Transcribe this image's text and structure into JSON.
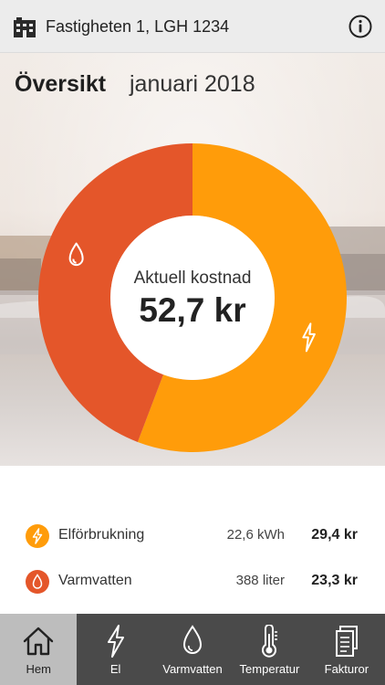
{
  "header": {
    "property": "Fastigheten 1, LGH 1234",
    "building_icon": "building-icon",
    "info_icon": "info-icon"
  },
  "overview": {
    "heading": "Översikt",
    "month": "januari 2018",
    "caption": "Aktuell kostnad",
    "total": "52,7 kr"
  },
  "chart_data": {
    "type": "pie",
    "categories": [
      "Elförbrukning",
      "Varmvatten"
    ],
    "values": [
      29.4,
      23.3
    ],
    "colors": [
      "#ff9c0a",
      "#e4562a"
    ]
  },
  "breakdown": [
    {
      "label": "Elförbrukning",
      "amount": "22,6 kWh",
      "cost": "29,4 kr",
      "icon": "lightning-icon",
      "color": "#ff9c0a"
    },
    {
      "label": "Varmvatten",
      "amount": "388 liter",
      "cost": "23,3 kr",
      "icon": "water-drop-icon",
      "color": "#e4562a"
    }
  ],
  "tabs": [
    {
      "label": "Hem",
      "icon": "home-icon",
      "active": true
    },
    {
      "label": "El",
      "icon": "lightning-icon",
      "active": false
    },
    {
      "label": "Varmvatten",
      "icon": "water-drop-icon",
      "active": false
    },
    {
      "label": "Temperatur",
      "icon": "thermometer-icon",
      "active": false
    },
    {
      "label": "Fakturor",
      "icon": "invoice-icon",
      "active": false
    }
  ]
}
